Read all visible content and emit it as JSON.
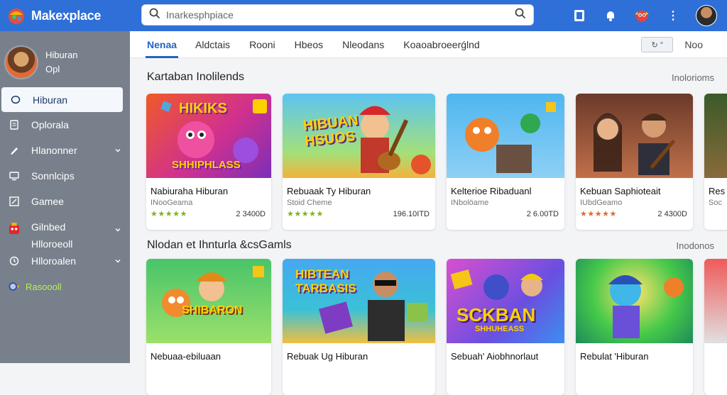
{
  "app": {
    "title": "Makexplace"
  },
  "search": {
    "placeholder": "Inarkesphpiace"
  },
  "sidebar": {
    "profile": {
      "line1": "Hiburan",
      "line2": "Opl"
    },
    "items": [
      {
        "label": "Hiburan",
        "icon": "chat-bubble-icon",
        "active": true
      },
      {
        "label": "Oplorala",
        "icon": "document-icon"
      },
      {
        "label": "Hlanonner",
        "icon": "brush-icon",
        "chevron": true
      },
      {
        "label": "Sonnlcips",
        "icon": "monitor-icon"
      },
      {
        "label": "Gamee",
        "icon": "edit-box-icon"
      },
      {
        "label": "Gilnbed",
        "label2": "Hlloroeoll",
        "icon": "game-character-icon",
        "chevron": true
      },
      {
        "label": "Hlloroalen",
        "icon": "clock-icon",
        "chevron": true
      },
      {
        "label": "Rasoooll",
        "icon": "settings-sparkle-icon"
      }
    ]
  },
  "tabs": [
    "Nenaa",
    "Aldctais",
    "Rooni",
    "Hbeos",
    "Nleodans",
    "Koaoabroeerǵlnd"
  ],
  "tab_right": {
    "toggle": "↻ °",
    "label": "Noo"
  },
  "sections": [
    {
      "title": "Kartaban Inolilends",
      "link": "Inolorioms",
      "cards": [
        {
          "title": "Nabiuraha Hiburan",
          "sub": "INooGeama",
          "stars": "★★★★★",
          "star_color": "#7cb518",
          "price": "2 3400D"
        },
        {
          "title": "Rebuaak Ty Hiburan",
          "sub": "Stoid Cheme",
          "stars": "★★★★★",
          "star_color": "#7cb518",
          "price": "196.10ITD"
        },
        {
          "title": "Kelterioe Ribaduanl",
          "sub": "INbolöame",
          "stars": "",
          "star_color": "#7cb518",
          "price": "2 6.00TD"
        },
        {
          "title": "Kebuan Saphioteait",
          "sub": "IUbdGeamo",
          "stars": "★★★★★",
          "star_color": "#e06b2d",
          "price": "2 4300D"
        },
        {
          "title": "Res",
          "sub": "Soc",
          "stars": "",
          "star_color": "#7cb518",
          "price": ""
        }
      ]
    },
    {
      "title": "Nlodan et Ihnturla &csGamls",
      "link": "Inodonos",
      "cards": [
        {
          "title": "Nebuaa-ebiluaan",
          "sub": "",
          "stars": "",
          "star_color": "#7cb518",
          "price": ""
        },
        {
          "title": "Rebuak Ug Hiburan",
          "sub": "",
          "stars": "",
          "star_color": "#7cb518",
          "price": ""
        },
        {
          "title": "Sebuah' Aiobhnorlaut",
          "sub": "",
          "stars": "",
          "star_color": "#7cb518",
          "price": ""
        },
        {
          "title": "Rebulat 'Hiburan",
          "sub": "",
          "stars": "",
          "star_color": "#7cb518",
          "price": ""
        },
        {
          "title": "",
          "sub": "",
          "stars": "",
          "star_color": "#7cb518",
          "price": ""
        }
      ]
    }
  ],
  "thumbs": {
    "s1c1_text": "HIKIKS",
    "s1c1_text2": "SHHIPHLASS",
    "s1c2_text": "HIBUAN HSUOS",
    "s2c2_text": "HIBTEAN TARBASIS",
    "s2c3_text": "SCKBAN",
    "s2c3_text2": "SHHUHEASS",
    "s2c1_text": "SHIBARON"
  }
}
